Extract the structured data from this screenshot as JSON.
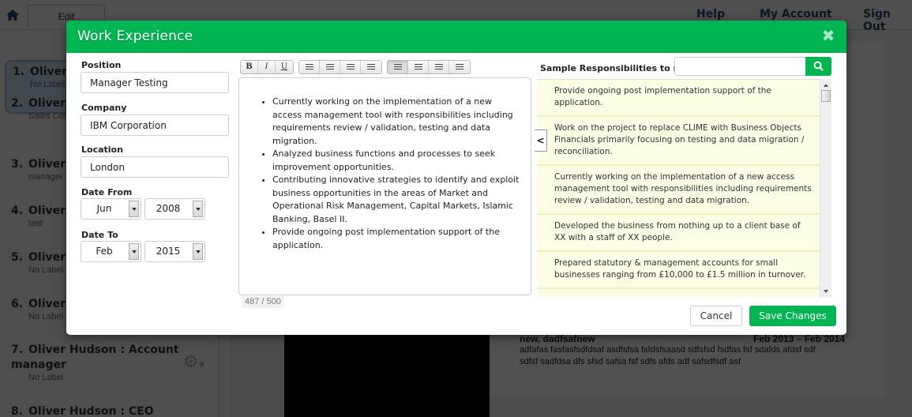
{
  "background": {
    "home_icon": "home-icon",
    "edit_tab": "Edit",
    "nav_links": [
      "Help",
      "My Account",
      "Sign Out"
    ],
    "entries": [
      {
        "num": "1.",
        "title": "Oliver Hudson : Executive",
        "sub": "No Label"
      },
      {
        "num": "2.",
        "title": "Oliver Hudson : Consultant",
        "sub": "Sales Consultant"
      },
      {
        "num": "3.",
        "title": "Oliver Hudson",
        "sub": "manager"
      },
      {
        "num": "4.",
        "title": "Oliver Hudson",
        "sub": "test"
      },
      {
        "num": "5.",
        "title": "Oliver Hudson",
        "sub": "No Label"
      },
      {
        "num": "6.",
        "title": "Oliver Hudson",
        "sub": "No Label"
      },
      {
        "num": "7.",
        "title": "Oliver Hudson : Account manager",
        "sub": "No Label"
      },
      {
        "num": "8.",
        "title": "Oliver Hudson : CEO",
        "sub": ""
      }
    ],
    "experience": {
      "heading": "new, dadfsafnew",
      "dates": "Feb 2013 – Feb 2014",
      "line1": "adfafas fasfasfsdfdsaf asdfsfsa fsfdsfsaasd sdfsfsd fsdfas fsf sdafds afdsf sdf",
      "line2": "sdfsf sadfdsa dfs sfsd safsa fsf sdfs afds adf safsdfsdf asf"
    }
  },
  "modal": {
    "title": "Work Experience",
    "close_icon": "close-icon",
    "position": {
      "label": "Position",
      "value": "Manager Testing"
    },
    "company": {
      "label": "Company",
      "value": "IBM Corporation"
    },
    "location": {
      "label": "Location",
      "value": "London"
    },
    "date_from": {
      "label": "Date From",
      "month": "Jun",
      "year": "2008"
    },
    "date_to": {
      "label": "Date To",
      "month": "Feb",
      "year": "2015"
    },
    "toolbar": {
      "bold": "B",
      "italic": "I",
      "underline": "U"
    },
    "editor_bullets": [
      "Currently working on the implementation of a new access management tool with responsibilities including requirements review / validation, testing and data migration.",
      "Analyzed business functions and processes to seek improvement opportunities.",
      "Contributing innovative strategies to identify and exploit business opportunities in the areas of Market and Operational Risk Management, Capital Markets, Islamic Banking, Basel II.",
      "Provide ongoing post implementation support of the application."
    ],
    "char_count": "487 / 500",
    "samples": {
      "label": "Sample Responsibilities to review",
      "search_placeholder": "",
      "search_value": "",
      "items": [
        "Provide ongoing post implementation support of the application.",
        "Work on the project to replace CLIME with Business Objects Financials primarily focusing on testing and data migration / reconciliation.",
        "Currently working on the implementation of a new access management tool with responsibilities including requirements review / validation, testing and data migration.",
        "Developed the business from nothing up to a client base of XX with a staff of XX people.",
        "Prepared statutory & management accounts for small businesses ranging from £10,000 to £1.5 million in turnover."
      ]
    },
    "cancel_label": "Cancel",
    "save_label": "Save Changes"
  },
  "colors": {
    "accent": "#00b552",
    "sample_bg": "#fdfde6"
  }
}
